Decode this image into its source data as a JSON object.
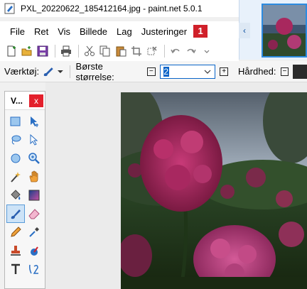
{
  "window": {
    "title": "PXL_20220622_185412164.jpg - paint.net 5.0.1"
  },
  "menu": {
    "items": [
      {
        "label": "File"
      },
      {
        "label": "Ret"
      },
      {
        "label": "Vis"
      },
      {
        "label": "Billede"
      },
      {
        "label": "Lag"
      },
      {
        "label": "Justeringer"
      }
    ],
    "badge": "1"
  },
  "toolbar": {
    "icons": [
      "new-icon",
      "open-icon",
      "save-icon",
      "print-icon",
      "cut-icon",
      "copy-icon",
      "paste-icon",
      "crop-icon",
      "deselect-icon",
      "undo-icon",
      "redo-icon",
      "more-icon"
    ]
  },
  "options": {
    "tool_label": "Værktøj:",
    "brush_size_label": "Børste størrelse:",
    "brush_size_value": "2",
    "hardness_label": "Hårdhed:"
  },
  "tools_panel": {
    "title": "V...",
    "close": "x",
    "icons": [
      "rectangle-select-icon",
      "move-selection-icon",
      "lasso-select-icon",
      "move-selected-icon",
      "ellipse-select-icon",
      "zoom-icon",
      "magic-wand-icon",
      "pan-icon",
      "paint-bucket-icon",
      "gradient-icon",
      "paintbrush-icon",
      "eraser-icon",
      "pencil-icon",
      "color-picker-icon",
      "clone-stamp-icon",
      "recolor-icon",
      "text-icon",
      "line-curve-icon"
    ]
  },
  "colors": {
    "accent": "#0a64c8",
    "badge": "#d0202a",
    "close": "#e3202c"
  }
}
